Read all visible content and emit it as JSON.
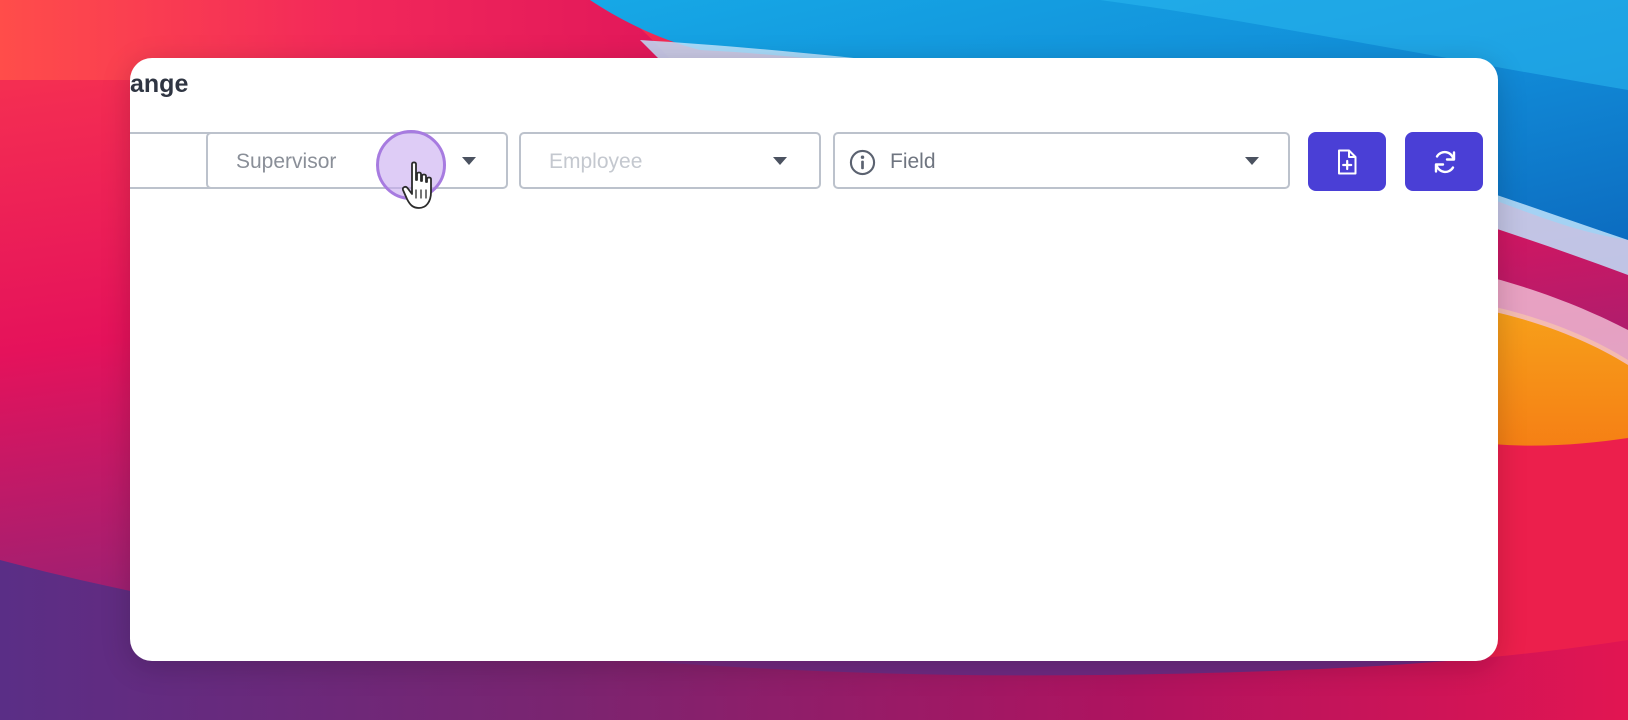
{
  "window": {
    "title": "ange"
  },
  "filters": {
    "first_select": {
      "label": ""
    },
    "supervisor": {
      "placeholder": "Supervisor"
    },
    "employee": {
      "placeholder": "Employee"
    },
    "field": {
      "placeholder": "Field"
    }
  },
  "toolbar": {
    "export_icon": "file-plus-icon",
    "refresh_icon": "refresh-icon"
  },
  "colors": {
    "accent": "#4a3fd6",
    "cursor_highlight": "#a77be0",
    "border": "#bcc2cc"
  }
}
